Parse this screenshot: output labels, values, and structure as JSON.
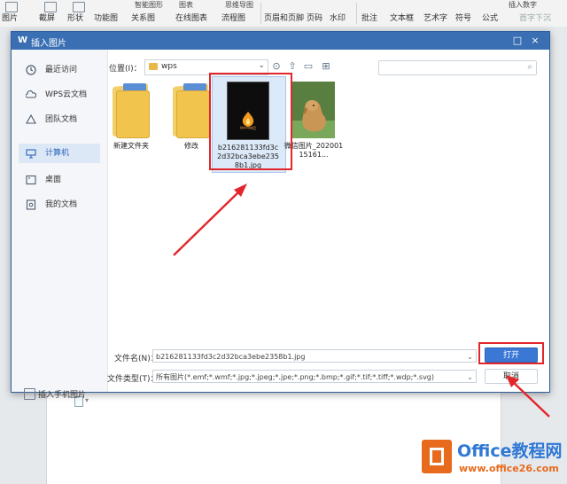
{
  "ribbon": {
    "items": [
      "图片",
      "截屏",
      "形状",
      "功能图",
      "关系图",
      "在线图表",
      "流程图",
      "页眉和页脚",
      "页码",
      "水印",
      "批注",
      "文本框",
      "艺术字",
      "符号",
      "公式"
    ],
    "top_items": [
      "智能图形",
      "图表",
      "思维导图",
      "插入数字",
      "首字下沉"
    ]
  },
  "dialog": {
    "title": "插入图片",
    "close": "×",
    "maximize": "□",
    "sidebar": [
      "最近访问",
      "WPS云文档",
      "团队文档",
      "计算机",
      "桌面",
      "我的文档"
    ],
    "active_index": 3,
    "location_label": "位置(I)：",
    "location_value": "wps",
    "files": [
      {
        "name": "新建文件夹",
        "kind": "folder"
      },
      {
        "name": "修改",
        "kind": "folder"
      },
      {
        "name": "b216281133fd3c2d32bca3ebe2358b1.jpg",
        "kind": "image-fire"
      },
      {
        "name": "微信图片_20200115161...",
        "kind": "image-dog"
      }
    ],
    "filename_label": "文件名(N)：",
    "filename_value": "b216281133fd3c2d32bca3ebe2358b1.jpg",
    "filetype_label": "文件类型(T)：",
    "filetype_value": "所有图片(*.emf;*.wmf;*.jpg;*.jpeg;*.jpe;*.png;*.bmp;*.gif;*.tif;*.tiff;*.wdp;*.svg)",
    "open_button": "打开",
    "cancel_button": "取消",
    "phone_link": "插入手机图片"
  },
  "watermark": {
    "brand": "Office教程网",
    "url": "www.office26.com"
  },
  "colors": {
    "title_bar": "#3a6fb3",
    "primary_button": "#3b78d6",
    "highlight": "#e2262c",
    "watermark_orange": "#e86a1c",
    "watermark_blue": "#2f78d6"
  }
}
